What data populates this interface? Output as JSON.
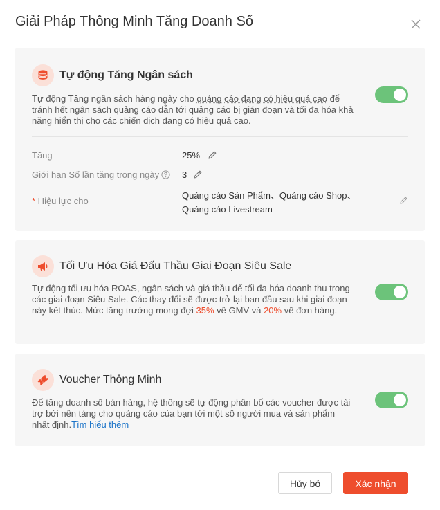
{
  "dialog": {
    "title": "Giải Pháp Thông Minh Tăng Doanh Số"
  },
  "auto_budget": {
    "title": "Tự động Tăng Ngân sách",
    "desc_part1": "Tự động Tăng ngân sách hàng ngày cho ",
    "desc_underlined": "quảng cáo đang có hiệu quả cao",
    "desc_part2": " để tránh hết ngân sách quảng cáo dẫn tới quảng cáo bị gián đoạn và tối đa hóa khả năng hiển thị cho các chiến dịch đang có hiệu quả cao.",
    "toggle_on": true,
    "increase_label": "Tăng",
    "increase_value": "25%",
    "limit_label": "Giới hạn Số lần tăng trong ngày",
    "limit_value": "3",
    "apply_required_mark": "*",
    "apply_label": " Hiệu lực cho",
    "apply_line1": "Quảng cáo Sản Phẩm、Quảng cáo Shop、",
    "apply_line2": "Quảng cáo Livestream"
  },
  "super_sale": {
    "title": "Tối Ưu Hóa Giá Đấu Thầu Giai Đoạn Siêu Sale",
    "desc_part1": "Tự động tối ưu hóa ROAS, ngân sách và giá thầu để tối đa hóa doanh thu trong các giai đoạn Siêu Sale. Các thay đổi sẽ được trở lại ban đầu sau khi giai đoạn này kết thúc. Mức tăng trưởng mong đợi ",
    "gmv_pct": "35%",
    "desc_part2": " về GMV và ",
    "order_pct": "20%",
    "desc_part3": " về đơn hàng.",
    "toggle_on": true
  },
  "smart_voucher": {
    "title": "Voucher Thông Minh",
    "desc": "Để tăng doanh số bán hàng, hệ thống sẽ tự động phân bổ các voucher được tài trợ bởi nền tảng cho quảng cáo của bạn tới một số người mua và sản phẩm nhất định.",
    "link": "Tìm hiểu thêm",
    "toggle_on": true
  },
  "footer": {
    "cancel_label": "Hủy bỏ",
    "confirm_label": "Xác nhận"
  },
  "colors": {
    "accent": "#ee4d2d",
    "toggle_on": "#6cc37a",
    "link": "#1a73c8",
    "icon_bg": "#fbe0d8"
  },
  "icons": {
    "close": "close-icon",
    "budget": "database-coins-icon",
    "super_sale": "megaphone-icon",
    "voucher": "ticket-icon",
    "edit": "pencil-icon",
    "help": "question-circle-icon"
  }
}
